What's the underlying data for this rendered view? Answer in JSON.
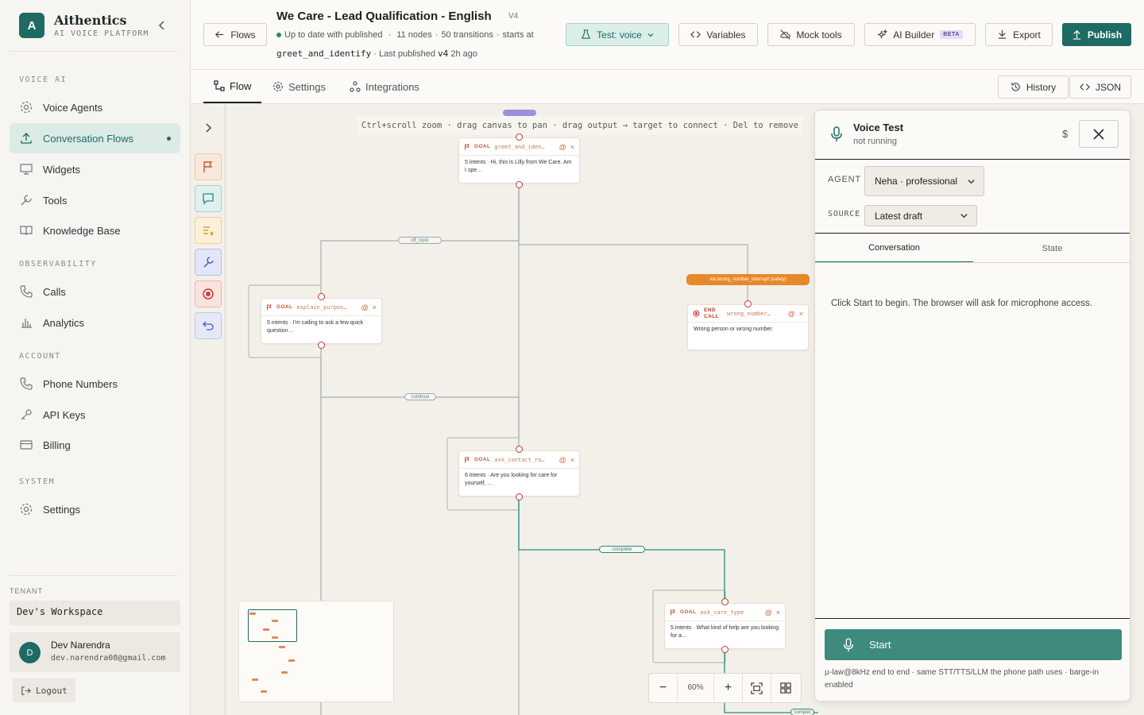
{
  "brand": {
    "name": "Aithentics",
    "subtitle": "AI VOICE PLATFORM",
    "logo_letter": "A"
  },
  "sidebar": {
    "sections": [
      {
        "label": "VOICE AI"
      },
      {
        "label": "OBSERVABILITY"
      },
      {
        "label": "ACCOUNT"
      },
      {
        "label": "SYSTEM"
      }
    ],
    "items": [
      {
        "label": "Voice Agents",
        "icon": "gear-icon"
      },
      {
        "label": "Conversation Flows",
        "icon": "upload-icon",
        "active": true
      },
      {
        "label": "Widgets",
        "icon": "monitor-icon"
      },
      {
        "label": "Tools",
        "icon": "wrench-icon"
      },
      {
        "label": "Knowledge Base",
        "icon": "book-icon"
      },
      {
        "label": "Calls",
        "icon": "phone-icon"
      },
      {
        "label": "Analytics",
        "icon": "bar-chart-icon"
      },
      {
        "label": "Phone Numbers",
        "icon": "phone-icon"
      },
      {
        "label": "API Keys",
        "icon": "key-icon"
      },
      {
        "label": "Billing",
        "icon": "credit-card-icon"
      },
      {
        "label": "Settings",
        "icon": "gear-icon"
      }
    ],
    "tenant_label": "TENANT",
    "tenant": "Dev's Workspace",
    "user": {
      "initial": "D",
      "name": "Dev Narendra",
      "email": "dev.narendra08@gmail.com"
    },
    "logout": "Logout"
  },
  "header": {
    "back_label": "Flows",
    "title": "We Care - Lead Qualification - English",
    "version": "V4",
    "status": "Up to date with published",
    "nodes": "11 nodes",
    "transitions": "50 transitions",
    "starts_at_label": "starts at",
    "start_node": "greet_and_identify",
    "last_published_label": "Last published",
    "last_published_version": "v4",
    "last_published_ago": "2h ago",
    "test_label": "Test: voice",
    "variables_label": "Variables",
    "mock_tools_label": "Mock tools",
    "ai_builder_label": "AI Builder",
    "beta_label": "BETA",
    "export_label": "Export",
    "publish_label": "Publish"
  },
  "tabs": [
    {
      "label": "Flow",
      "active": true
    },
    {
      "label": "Settings"
    },
    {
      "label": "Integrations"
    }
  ],
  "tab_actions": {
    "history": "History",
    "json": "JSON"
  },
  "canvas": {
    "hint": "Ctrl+scroll zoom · drag canvas to pan · drag output → target to connect · Del to remove",
    "nodes": [
      {
        "kind": "GOAL",
        "id": "greet_and_iden…",
        "body": "5 intents · Hi, this is Lilly from We Care. Am I spe…"
      },
      {
        "kind": "GOAL",
        "id": "explain_purpos…",
        "body": "5 intents · I'm calling to ask a few quick question…"
      },
      {
        "kind": "END CALL",
        "id": "wrong_number…",
        "body": "Wrong person or wrong number."
      },
      {
        "kind": "GOAL",
        "id": "ask_contact_ro…",
        "body": "6 intents · Are you looking for care for yourself, …"
      },
      {
        "kind": "GOAL",
        "id": "ask_care_type",
        "body": "5 intents · What kind of help are you looking for a…"
      }
    ],
    "edge_labels": {
      "off_topic": "off_topic",
      "continue": "continue",
      "complete": "complete",
      "complete2": "complet",
      "safety": "via wrong_number_interrupt (safety)"
    },
    "zoom": "60%"
  },
  "voice_panel": {
    "title": "Voice Test",
    "status": "not running",
    "cost_symbol": "$",
    "agent_label": "AGENT",
    "agent_value": "Neha · professional",
    "source_label": "SOURCE",
    "source_value": "Latest draft",
    "tabs": [
      "Conversation",
      "State"
    ],
    "message": "Click Start to begin. The browser will ask for microphone access.",
    "start_label": "Start",
    "footer": "µ-law@8kHz end to end · same STT/TTS/LLM the phone path uses · barge-in enabled"
  },
  "colors": {
    "accent": "#1d6b63",
    "node_accent": "#c25b2f",
    "safety": "#e7892a"
  }
}
